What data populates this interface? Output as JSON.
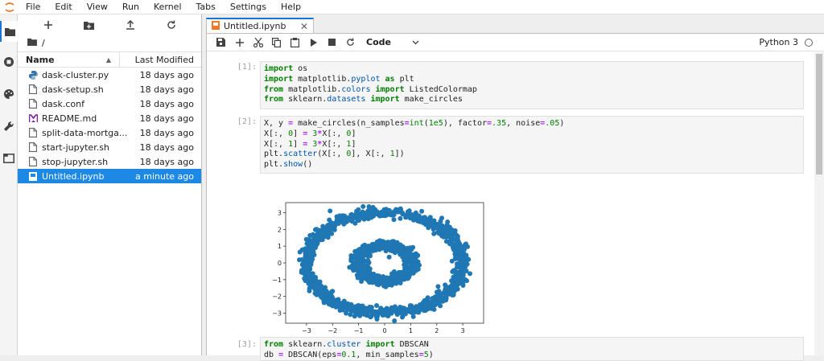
{
  "menubar": {
    "items": [
      "File",
      "Edit",
      "View",
      "Run",
      "Kernel",
      "Tabs",
      "Settings",
      "Help"
    ]
  },
  "activity_icons": [
    "folder-icon",
    "running-icon",
    "palette-icon",
    "wrench-icon",
    "tabs-icon"
  ],
  "filebrowser": {
    "breadcrumb": "/",
    "col_name": "Name",
    "col_modified": "Last Modified",
    "files": [
      {
        "name": "dask-cluster.py",
        "modified": "18 days ago",
        "icon": "python-icon",
        "selected": false
      },
      {
        "name": "dask-setup.sh",
        "modified": "18 days ago",
        "icon": "file-icon",
        "selected": false
      },
      {
        "name": "dask.conf",
        "modified": "18 days ago",
        "icon": "file-icon",
        "selected": false
      },
      {
        "name": "README.md",
        "modified": "18 days ago",
        "icon": "markdown-icon",
        "selected": false
      },
      {
        "name": "split-data-mortga...",
        "modified": "18 days ago",
        "icon": "file-icon",
        "selected": false
      },
      {
        "name": "start-jupyter.sh",
        "modified": "18 days ago",
        "icon": "file-icon",
        "selected": false
      },
      {
        "name": "stop-jupyter.sh",
        "modified": "18 days ago",
        "icon": "file-icon",
        "selected": false
      },
      {
        "name": "Untitled.ipynb",
        "modified": "a minute ago",
        "icon": "notebook-icon",
        "selected": true
      }
    ]
  },
  "tab": {
    "title": "Untitled.ipynb"
  },
  "toolbar": {
    "cell_type": "Code",
    "kernel": "Python 3"
  },
  "cells": [
    {
      "prompt": "[1]:"
    },
    {
      "prompt": "[2]:"
    },
    {
      "prompt": "[3]:"
    }
  ],
  "chart_data": {
    "type": "scatter",
    "description": "two concentric rings",
    "x_ticks": [
      "−3",
      "−2",
      "−1",
      "0",
      "1",
      "2",
      "3"
    ],
    "y_ticks": [
      "3",
      "2",
      "1",
      "0",
      "−1",
      "−2",
      "−3"
    ],
    "xlim": [
      -3.8,
      3.8
    ],
    "ylim": [
      -3.6,
      3.6
    ],
    "outer_ring_radius": 3.0,
    "inner_ring_radius": 1.05,
    "noise": 0.15,
    "color": "#1f77b4"
  },
  "colors": {
    "accent": "#1976d2",
    "selection": "#1e88e5",
    "scatter": "#1f77b4"
  }
}
